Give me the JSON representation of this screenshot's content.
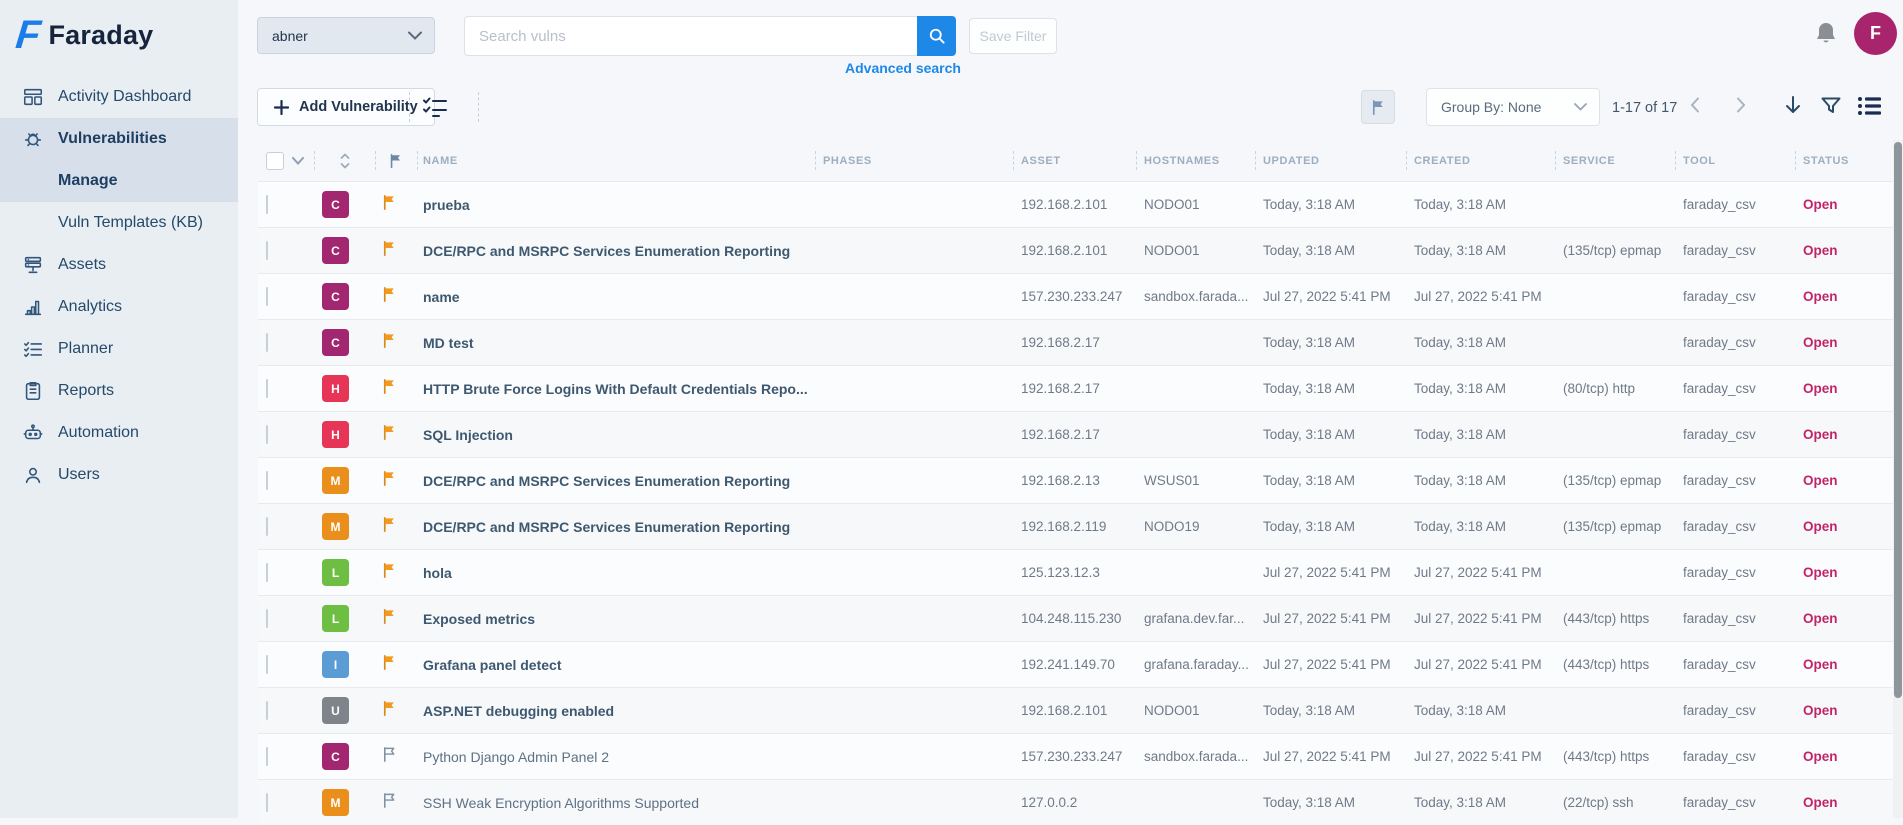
{
  "brand": "Faraday",
  "sidebar": {
    "items": [
      {
        "label": "Activity Dashboard"
      },
      {
        "label": "Vulnerabilities"
      },
      {
        "label": "Manage"
      },
      {
        "label": "Vuln Templates (KB)"
      },
      {
        "label": "Assets"
      },
      {
        "label": "Analytics"
      },
      {
        "label": "Planner"
      },
      {
        "label": "Reports"
      },
      {
        "label": "Automation"
      },
      {
        "label": "Users"
      }
    ]
  },
  "topbar": {
    "workspace_selected": "abner",
    "search_placeholder": "Search vulns",
    "save_filter_label": "Save Filter",
    "advanced_search_label": "Advanced search",
    "user_initial": "F"
  },
  "toolbar": {
    "add_vulnerability_label": "Add Vulnerability",
    "group_by_label": "Group By: None",
    "pagination_range": "1-17 of 17"
  },
  "table": {
    "headers": {
      "name": "NAME",
      "phases": "PHASES",
      "asset": "ASSET",
      "hostnames": "HOSTNAMES",
      "updated": "UPDATED",
      "created": "CREATED",
      "service": "SERVICE",
      "tool": "TOOL",
      "status": "STATUS"
    },
    "rows": [
      {
        "severity": "C",
        "flagged": true,
        "name": "prueba",
        "phases": "",
        "asset": "192.168.2.101",
        "hostnames": "NODO01",
        "updated": "Today, 3:18 AM",
        "created": "Today, 3:18 AM",
        "service": "",
        "tool": "faraday_csv",
        "status": "Open"
      },
      {
        "severity": "C",
        "flagged": true,
        "name": "DCE/RPC and MSRPC Services Enumeration Reporting",
        "phases": "",
        "asset": "192.168.2.101",
        "hostnames": "NODO01",
        "updated": "Today, 3:18 AM",
        "created": "Today, 3:18 AM",
        "service": "(135/tcp) epmap",
        "tool": "faraday_csv",
        "status": "Open"
      },
      {
        "severity": "C",
        "flagged": true,
        "name": "name",
        "phases": "",
        "asset": "157.230.233.247",
        "hostnames": "sandbox.farada...",
        "updated": "Jul 27, 2022 5:41 PM",
        "created": "Jul 27, 2022 5:41 PM",
        "service": "",
        "tool": "faraday_csv",
        "status": "Open"
      },
      {
        "severity": "C",
        "flagged": true,
        "name": "MD test",
        "phases": "",
        "asset": "192.168.2.17",
        "hostnames": "",
        "updated": "Today, 3:18 AM",
        "created": "Today, 3:18 AM",
        "service": "",
        "tool": "faraday_csv",
        "status": "Open"
      },
      {
        "severity": "H",
        "flagged": true,
        "name": "HTTP Brute Force Logins With Default Credentials Repo...",
        "phases": "",
        "asset": "192.168.2.17",
        "hostnames": "",
        "updated": "Today, 3:18 AM",
        "created": "Today, 3:18 AM",
        "service": "(80/tcp) http",
        "tool": "faraday_csv",
        "status": "Open"
      },
      {
        "severity": "H",
        "flagged": true,
        "name": "SQL Injection",
        "phases": "",
        "asset": "192.168.2.17",
        "hostnames": "",
        "updated": "Today, 3:18 AM",
        "created": "Today, 3:18 AM",
        "service": "",
        "tool": "faraday_csv",
        "status": "Open"
      },
      {
        "severity": "M",
        "flagged": true,
        "name": "DCE/RPC and MSRPC Services Enumeration Reporting",
        "phases": "",
        "asset": "192.168.2.13",
        "hostnames": "WSUS01",
        "updated": "Today, 3:18 AM",
        "created": "Today, 3:18 AM",
        "service": "(135/tcp) epmap",
        "tool": "faraday_csv",
        "status": "Open"
      },
      {
        "severity": "M",
        "flagged": true,
        "name": "DCE/RPC and MSRPC Services Enumeration Reporting",
        "phases": "",
        "asset": "192.168.2.119",
        "hostnames": "NODO19",
        "updated": "Today, 3:18 AM",
        "created": "Today, 3:18 AM",
        "service": "(135/tcp) epmap",
        "tool": "faraday_csv",
        "status": "Open"
      },
      {
        "severity": "L",
        "flagged": true,
        "name": "hola",
        "phases": "",
        "asset": "125.123.12.3",
        "hostnames": "",
        "updated": "Jul 27, 2022 5:41 PM",
        "created": "Jul 27, 2022 5:41 PM",
        "service": "",
        "tool": "faraday_csv",
        "status": "Open"
      },
      {
        "severity": "L",
        "flagged": true,
        "name": "Exposed metrics",
        "phases": "",
        "asset": "104.248.115.230",
        "hostnames": "grafana.dev.far...",
        "updated": "Jul 27, 2022 5:41 PM",
        "created": "Jul 27, 2022 5:41 PM",
        "service": "(443/tcp) https",
        "tool": "faraday_csv",
        "status": "Open"
      },
      {
        "severity": "I",
        "flagged": true,
        "name": "Grafana panel detect",
        "phases": "",
        "asset": "192.241.149.70",
        "hostnames": "grafana.faraday...",
        "updated": "Jul 27, 2022 5:41 PM",
        "created": "Jul 27, 2022 5:41 PM",
        "service": "(443/tcp) https",
        "tool": "faraday_csv",
        "status": "Open"
      },
      {
        "severity": "U",
        "flagged": true,
        "name": "ASP.NET debugging enabled",
        "phases": "",
        "asset": "192.168.2.101",
        "hostnames": "NODO01",
        "updated": "Today, 3:18 AM",
        "created": "Today, 3:18 AM",
        "service": "",
        "tool": "faraday_csv",
        "status": "Open"
      },
      {
        "severity": "C",
        "flagged": false,
        "name": "Python Django Admin Panel 2",
        "phases": "",
        "asset": "157.230.233.247",
        "hostnames": "sandbox.farada...",
        "updated": "Jul 27, 2022 5:41 PM",
        "created": "Jul 27, 2022 5:41 PM",
        "service": "(443/tcp) https",
        "tool": "faraday_csv",
        "status": "Open"
      },
      {
        "severity": "M",
        "flagged": false,
        "name": "SSH Weak Encryption Algorithms Supported",
        "phases": "",
        "asset": "127.0.0.2",
        "hostnames": "",
        "updated": "Today, 3:18 AM",
        "created": "Today, 3:18 AM",
        "service": "(22/tcp) ssh",
        "tool": "faraday_csv",
        "status": "Open"
      }
    ]
  },
  "colors": {
    "severity": {
      "C": "#A32671",
      "H": "#E73558",
      "M": "#EA8F1B",
      "L": "#6FBE44",
      "I": "#5C9CD5",
      "U": "#7E8489"
    },
    "accent_blue": "#1E88E8",
    "status_open": "#C2246A",
    "flag_orange": "#F2991F",
    "avatar_bg": "#A8246D"
  }
}
